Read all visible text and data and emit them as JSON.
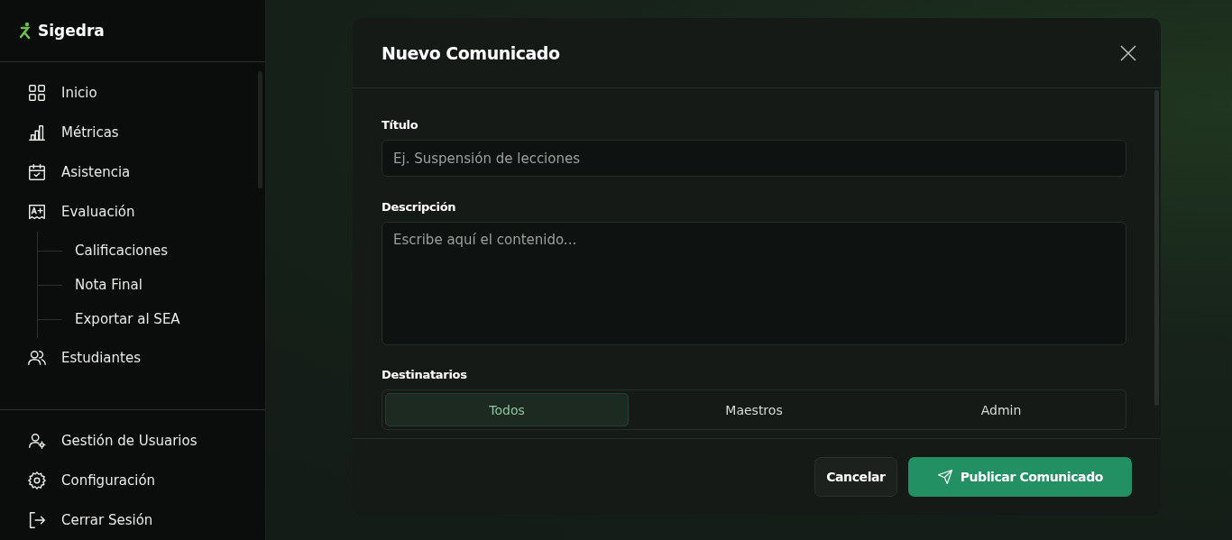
{
  "sidebar": {
    "brand": "Sigedra",
    "nav": [
      {
        "label": "Inicio",
        "kind": "grid"
      },
      {
        "label": "Métricas",
        "kind": "bars"
      },
      {
        "label": "Asistencia",
        "kind": "calendar"
      },
      {
        "label": "Evaluación",
        "kind": "grade",
        "expanded": true,
        "children": [
          {
            "label": "Calificaciones"
          },
          {
            "label": "Nota Final"
          },
          {
            "label": "Exportar al SEA"
          }
        ]
      },
      {
        "label": "Estudiantes",
        "kind": "users"
      }
    ],
    "footer_nav": [
      {
        "label": "Gestión de Usuarios",
        "kind": "usergear"
      },
      {
        "label": "Configuración",
        "kind": "gear"
      },
      {
        "label": "Cerrar Sesión",
        "kind": "logout"
      }
    ]
  },
  "modal": {
    "title": "Nuevo Comunicado",
    "fields": [
      {
        "kind": "input",
        "label": "Título",
        "placeholder": "Ej. Suspensión de lecciones"
      },
      {
        "kind": "textarea",
        "label": "Descripción",
        "placeholder": "Escribe aquí el contenido..."
      }
    ],
    "recipients": {
      "label": "Destinatarios",
      "options": [
        {
          "label": "Todos",
          "selected": true
        },
        {
          "label": "Maestros",
          "selected": false
        },
        {
          "label": "Admin",
          "selected": false
        }
      ]
    },
    "buttons": [
      {
        "kind": "secondary",
        "label": "Cancelar"
      },
      {
        "kind": "primary",
        "label": "Publicar Comunicado"
      }
    ]
  }
}
